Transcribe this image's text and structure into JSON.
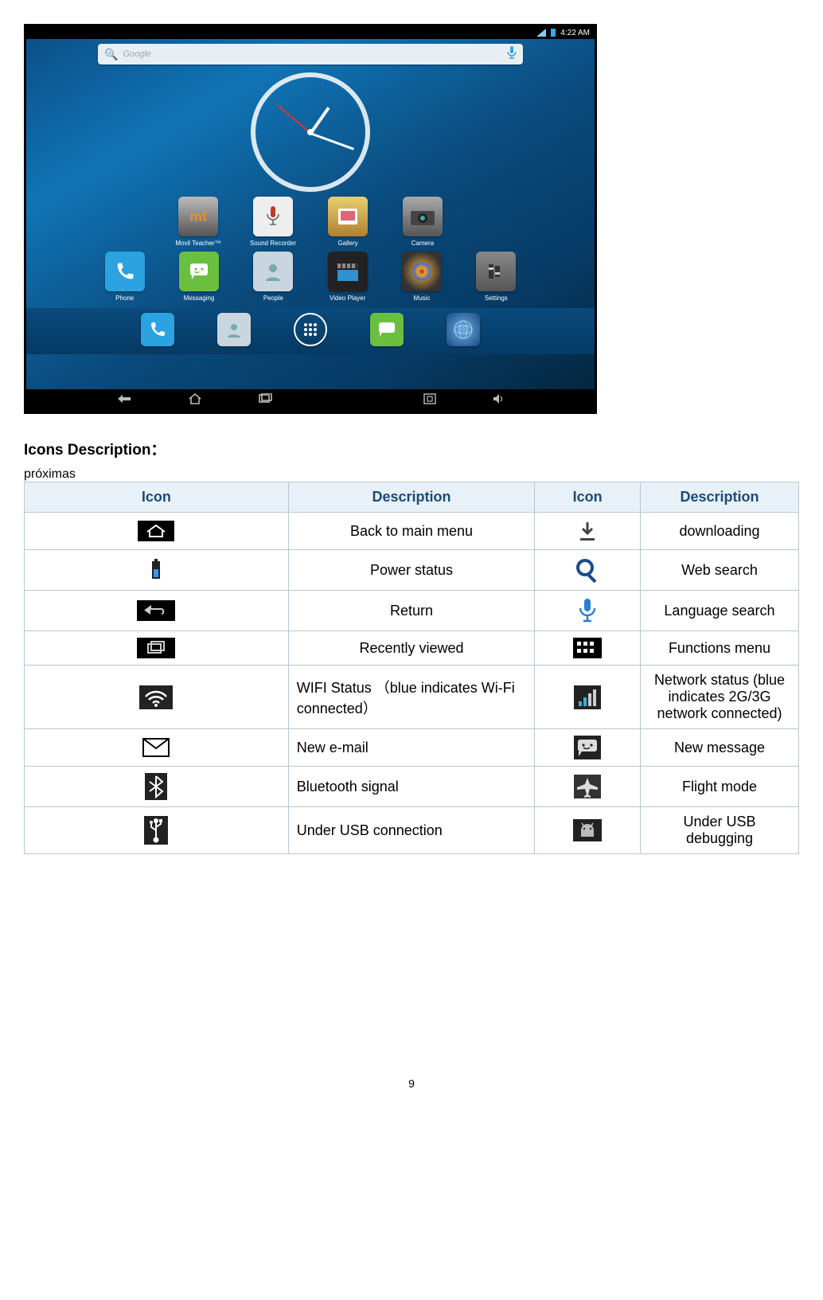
{
  "screenshot": {
    "status_time": "4:22 AM",
    "search_placeholder": "Google",
    "apps_row1": [
      {
        "name": "movil-teacher",
        "label": "Movil Teacher™",
        "bg": "#6a6a6a"
      },
      {
        "name": "sound-recorder",
        "label": "Sound Recorder",
        "bg": "#e8e8e8"
      },
      {
        "name": "gallery",
        "label": "Gallery",
        "bg": "#c7b07a"
      },
      {
        "name": "camera",
        "label": "Camera",
        "bg": "#6a6a6a"
      }
    ],
    "apps_row2": [
      {
        "name": "phone",
        "label": "Phone",
        "bg": "#2aa3e0"
      },
      {
        "name": "messaging",
        "label": "Messaging",
        "bg": "#6bbf3f"
      },
      {
        "name": "people",
        "label": "People",
        "bg": "#c9d6df"
      },
      {
        "name": "video-player",
        "label": "Video Player",
        "bg": "#222"
      },
      {
        "name": "music",
        "label": "Music",
        "bg": "#444"
      },
      {
        "name": "settings",
        "label": "Settings",
        "bg": "#6a6a6a"
      }
    ],
    "dock": [
      {
        "name": "phone",
        "bg": "#2aa3e0"
      },
      {
        "name": "messaging",
        "bg": "#6bbf3f"
      },
      {
        "name": "app-drawer",
        "bg": "#2a8bd0"
      },
      {
        "name": "messaging-alt",
        "bg": "#6bbf3f"
      },
      {
        "name": "browser",
        "bg": "#2a5aa0"
      }
    ]
  },
  "heading": "Icons Description：",
  "table": {
    "headers": [
      "Icon",
      "Description",
      "Icon",
      "Description"
    ],
    "rows": [
      {
        "left_icon": "home-icon",
        "left_desc": "Back to main menu",
        "right_icon": "download-icon",
        "right_desc": "downloading"
      },
      {
        "left_icon": "battery-icon",
        "left_desc": "Power status",
        "right_icon": "search-icon",
        "right_desc": "Web search"
      },
      {
        "left_icon": "return-icon",
        "left_desc": "Return",
        "right_icon": "mic-icon",
        "right_desc": "Language search"
      },
      {
        "left_icon": "recent-icon",
        "left_desc": "Recently viewed",
        "right_icon": "apps-grid-icon",
        "right_desc": "Functions menu"
      },
      {
        "left_icon": "wifi-icon",
        "left_desc": "WIFI Status （blue indicates Wi-Fi connected）",
        "right_icon": "network-bars-icon",
        "right_desc": "Network status (blue indicates 2G/3G network connected)"
      },
      {
        "left_icon": "mail-icon",
        "left_desc": "New e-mail",
        "right_icon": "message-icon",
        "right_desc": "New message"
      },
      {
        "left_icon": "bluetooth-icon",
        "left_desc": "Bluetooth signal",
        "right_icon": "flight-mode-icon",
        "right_desc": "Flight mode"
      },
      {
        "left_icon": "usb-icon",
        "left_desc": "Under USB connection",
        "right_icon": "android-icon",
        "right_desc": "Under USB debugging"
      }
    ]
  },
  "page_number": "9"
}
